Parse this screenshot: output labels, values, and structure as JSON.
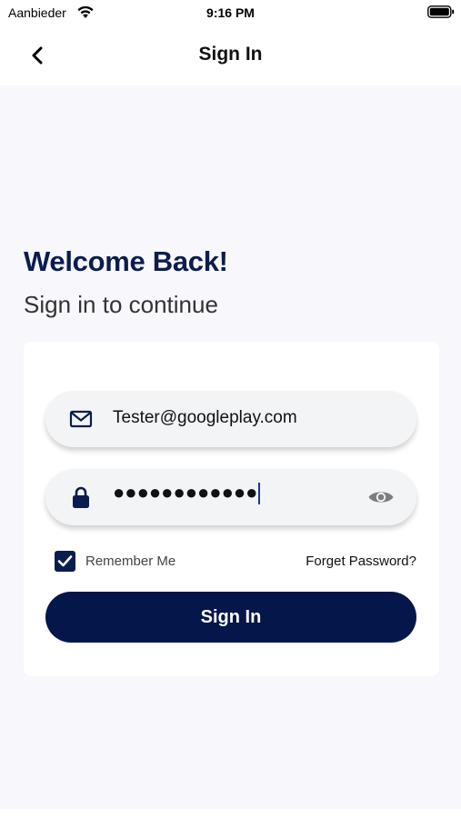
{
  "status_bar": {
    "carrier": "Aanbieder",
    "time": "9:16 PM",
    "wifi_icon": "wifi-icon",
    "battery_icon": "battery-icon"
  },
  "nav": {
    "title": "Sign In",
    "back_icon": "chevron-left-icon"
  },
  "header": {
    "title": "Welcome Back!",
    "subtitle": "Sign in to continue"
  },
  "form": {
    "email": {
      "icon": "mail-icon",
      "value": "Tester@googleplay.com"
    },
    "password": {
      "icon": "lock-icon",
      "masked_value": "●●●●●●●●●●●●",
      "toggle_icon": "eye-icon"
    },
    "remember_me": {
      "label": "Remember Me",
      "checked": true
    },
    "forgot_password_label": "Forget Password?",
    "submit_label": "Sign In"
  },
  "colors": {
    "primary": "#04164a",
    "title": "#0b1d4d",
    "background": "#f7f7fc",
    "card": "#ffffff",
    "field": "#f3f4f6"
  }
}
